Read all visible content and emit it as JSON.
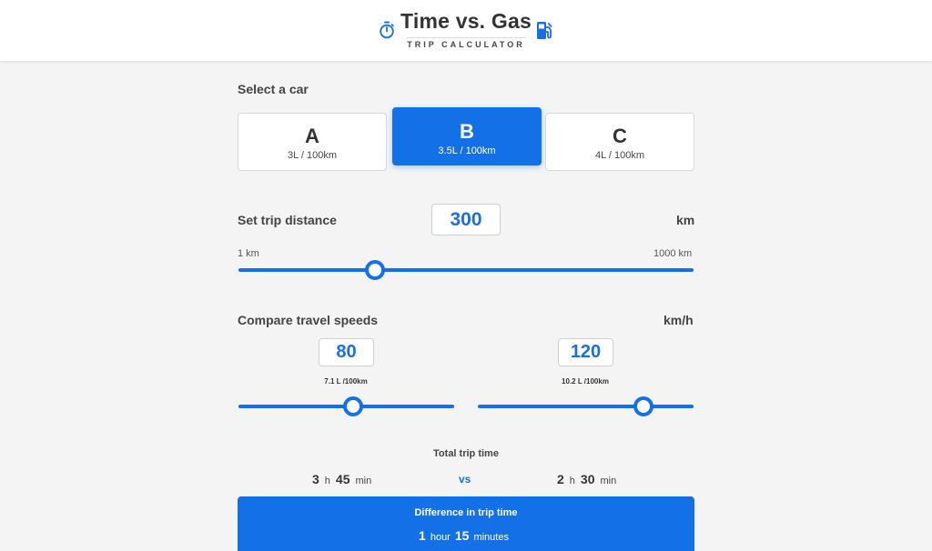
{
  "header": {
    "title": "Time vs. Gas",
    "subtitle": "TRIP CALCULATOR",
    "left_icon": "stopwatch-icon",
    "right_icon": "fuel-pump-icon",
    "accent_color": "#1470e6"
  },
  "car_section": {
    "label": "Select a car",
    "cars": [
      {
        "letter": "A",
        "efficiency": "3L / 100km",
        "selected": false
      },
      {
        "letter": "B",
        "efficiency": "3.5L / 100km",
        "selected": true
      },
      {
        "letter": "C",
        "efficiency": "4L / 100km",
        "selected": false
      }
    ]
  },
  "distance": {
    "label": "Set trip distance",
    "value": "300",
    "unit": "km",
    "min_label": "1 km",
    "max_label": "1000 km",
    "slider_min": 1,
    "slider_max": 1000,
    "slider_value": 300
  },
  "speeds": {
    "label": "Compare travel speeds",
    "unit": "km/h",
    "left": {
      "value": "80",
      "consumption": "7.1 L /100km",
      "slider_fraction": 0.53
    },
    "right": {
      "value": "120",
      "consumption": "10.2 L /100km",
      "slider_fraction": 0.77
    }
  },
  "totals": {
    "label": "Total trip time",
    "left": {
      "hours": "3",
      "h_unit": "h",
      "minutes": "45",
      "min_unit": "min"
    },
    "vs": "vs",
    "right": {
      "hours": "2",
      "h_unit": "h",
      "minutes": "30",
      "min_unit": "min"
    }
  },
  "difference": {
    "label": "Difference in trip time",
    "hours": "1",
    "hour_unit": "hour",
    "minutes": "15",
    "minute_unit": "minutes"
  }
}
